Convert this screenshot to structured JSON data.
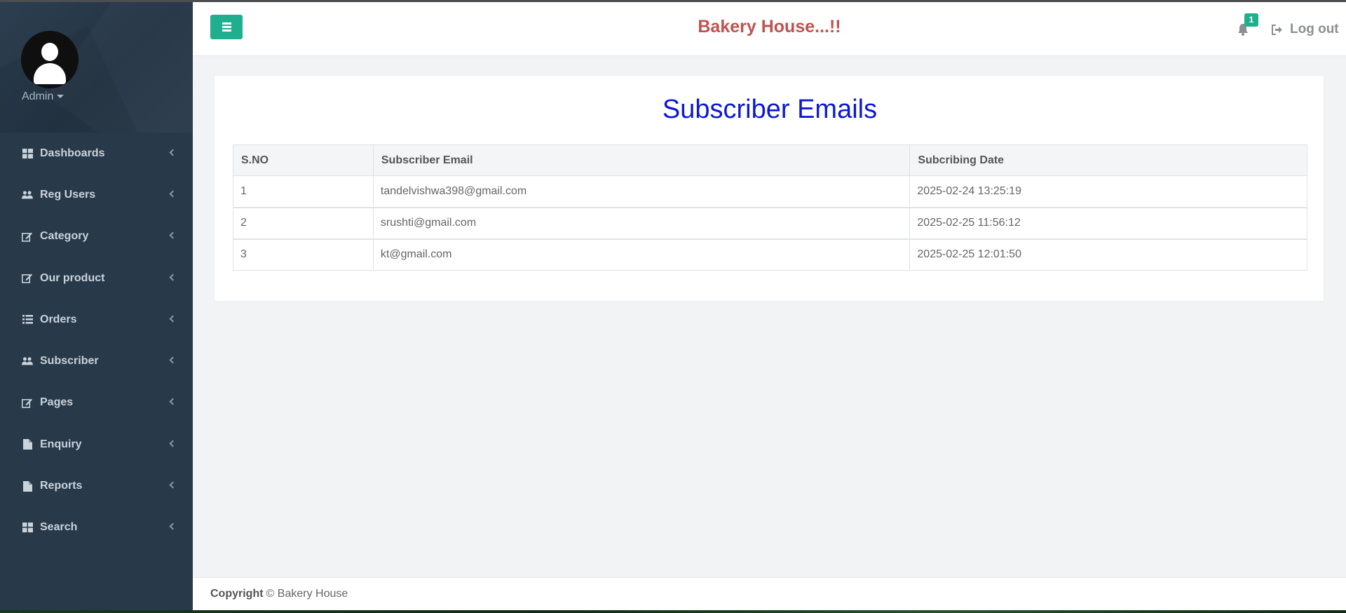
{
  "sidebar": {
    "user_name": "Admin",
    "items": [
      {
        "label": "Dashboards",
        "icon": "dashboard-icon"
      },
      {
        "label": "Reg Users",
        "icon": "users-icon"
      },
      {
        "label": "Category",
        "icon": "edit-icon"
      },
      {
        "label": "Our product",
        "icon": "edit-icon"
      },
      {
        "label": "Orders",
        "icon": "list-icon"
      },
      {
        "label": "Subscriber",
        "icon": "users-icon"
      },
      {
        "label": "Pages",
        "icon": "edit-icon"
      },
      {
        "label": "Enquiry",
        "icon": "file-icon"
      },
      {
        "label": "Reports",
        "icon": "file-icon"
      },
      {
        "label": "Search",
        "icon": "dashboard-icon"
      }
    ]
  },
  "header": {
    "brand": "Bakery House...!!",
    "notification_count": "1",
    "logout_label": "Log out"
  },
  "main": {
    "title": "Subscriber Emails",
    "table": {
      "columns": [
        "S.NO",
        "Subscriber Email",
        "Subcribing Date"
      ],
      "rows": [
        [
          "1",
          "tandelvishwa398@gmail.com",
          "2025-02-24 13:25:19"
        ],
        [
          "2",
          "srushti@gmail.com",
          "2025-02-25 11:56:12"
        ],
        [
          "3",
          "kt@gmail.com",
          "2025-02-25 12:01:50"
        ]
      ]
    }
  },
  "footer": {
    "copyright_label": "Copyright",
    "copyright_text": "© Bakery House"
  },
  "colors": {
    "accent": "#1fae8e",
    "brand": "#c0524f",
    "title": "#0c18d4",
    "sidebar_bg": "#283949"
  }
}
